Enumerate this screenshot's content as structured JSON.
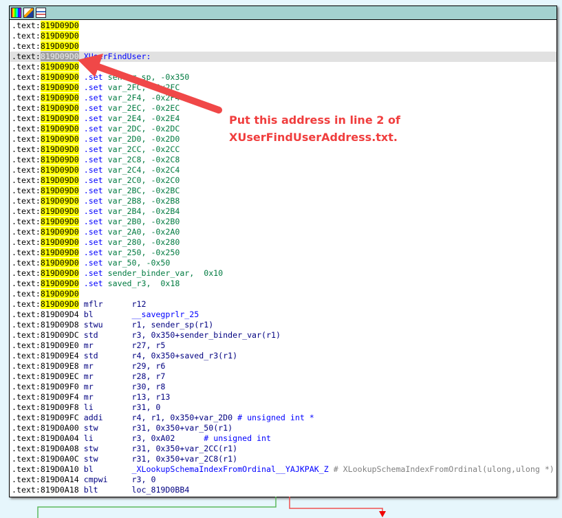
{
  "toolbar": {
    "icons": [
      "color-palette-icon",
      "edit-pencil-icon",
      "graph-view-icon"
    ]
  },
  "annotation": {
    "line1": "Put this address in line 2 of",
    "line2": "XUserFindUserAddress.txt.",
    "color": "#f04040"
  },
  "code_lines": [
    {
      "seg": ".text:",
      "addr": "819D09D0",
      "hl": true
    },
    {
      "seg": ".text:",
      "addr": "819D09D0",
      "hl": true
    },
    {
      "seg": ".text:",
      "addr": "819D09D0",
      "hl": true
    },
    {
      "seg": ".text:",
      "addr": "819D09D0",
      "hl": true,
      "label": "XUserFindUser:",
      "cur": true
    },
    {
      "seg": ".text:",
      "addr": "819D09D0",
      "hl": true
    },
    {
      "seg": ".text:",
      "addr": "819D09D0",
      "hl": true,
      "mn": ".set",
      "op": "sender_sp, -0x350"
    },
    {
      "seg": ".text:",
      "addr": "819D09D0",
      "hl": true,
      "mn": ".set",
      "op": "var_2FC, -0x2FC"
    },
    {
      "seg": ".text:",
      "addr": "819D09D0",
      "hl": true,
      "mn": ".set",
      "op": "var_2F4, -0x2F4"
    },
    {
      "seg": ".text:",
      "addr": "819D09D0",
      "hl": true,
      "mn": ".set",
      "op": "var_2EC, -0x2EC"
    },
    {
      "seg": ".text:",
      "addr": "819D09D0",
      "hl": true,
      "mn": ".set",
      "op": "var_2E4, -0x2E4"
    },
    {
      "seg": ".text:",
      "addr": "819D09D0",
      "hl": true,
      "mn": ".set",
      "op": "var_2DC, -0x2DC"
    },
    {
      "seg": ".text:",
      "addr": "819D09D0",
      "hl": true,
      "mn": ".set",
      "op": "var_2D0, -0x2D0"
    },
    {
      "seg": ".text:",
      "addr": "819D09D0",
      "hl": true,
      "mn": ".set",
      "op": "var_2CC, -0x2CC"
    },
    {
      "seg": ".text:",
      "addr": "819D09D0",
      "hl": true,
      "mn": ".set",
      "op": "var_2C8, -0x2C8"
    },
    {
      "seg": ".text:",
      "addr": "819D09D0",
      "hl": true,
      "mn": ".set",
      "op": "var_2C4, -0x2C4"
    },
    {
      "seg": ".text:",
      "addr": "819D09D0",
      "hl": true,
      "mn": ".set",
      "op": "var_2C0, -0x2C0"
    },
    {
      "seg": ".text:",
      "addr": "819D09D0",
      "hl": true,
      "mn": ".set",
      "op": "var_2BC, -0x2BC"
    },
    {
      "seg": ".text:",
      "addr": "819D09D0",
      "hl": true,
      "mn": ".set",
      "op": "var_2B8, -0x2B8"
    },
    {
      "seg": ".text:",
      "addr": "819D09D0",
      "hl": true,
      "mn": ".set",
      "op": "var_2B4, -0x2B4"
    },
    {
      "seg": ".text:",
      "addr": "819D09D0",
      "hl": true,
      "mn": ".set",
      "op": "var_2B0, -0x2B0"
    },
    {
      "seg": ".text:",
      "addr": "819D09D0",
      "hl": true,
      "mn": ".set",
      "op": "var_2A0, -0x2A0"
    },
    {
      "seg": ".text:",
      "addr": "819D09D0",
      "hl": true,
      "mn": ".set",
      "op": "var_280, -0x280"
    },
    {
      "seg": ".text:",
      "addr": "819D09D0",
      "hl": true,
      "mn": ".set",
      "op": "var_250, -0x250"
    },
    {
      "seg": ".text:",
      "addr": "819D09D0",
      "hl": true,
      "mn": ".set",
      "op": "var_50, -0x50"
    },
    {
      "seg": ".text:",
      "addr": "819D09D0",
      "hl": true,
      "mn": ".set",
      "op": "sender_binder_var,  0x10"
    },
    {
      "seg": ".text:",
      "addr": "819D09D0",
      "hl": true,
      "mn": ".set",
      "op": "saved_r3,  0x18"
    },
    {
      "seg": ".text:",
      "addr": "819D09D0",
      "hl": true
    },
    {
      "seg": ".text:",
      "addr": "819D09D0",
      "hl": true,
      "mn": "mflr",
      "op": "r12"
    },
    {
      "seg": ".text:",
      "addr": "819D09D4",
      "mn": "bl",
      "op": "__savegprlr_25"
    },
    {
      "seg": ".text:",
      "addr": "819D09D8",
      "mn": "stwu",
      "op": "r1, sender_sp(r1)"
    },
    {
      "seg": ".text:",
      "addr": "819D09DC",
      "mn": "std",
      "op": "r3, 0x350+sender_binder_var(r1)"
    },
    {
      "seg": ".text:",
      "addr": "819D09E0",
      "mn": "mr",
      "op": "r27, r5"
    },
    {
      "seg": ".text:",
      "addr": "819D09E4",
      "mn": "std",
      "op": "r4, 0x350+saved_r3(r1)"
    },
    {
      "seg": ".text:",
      "addr": "819D09E8",
      "mn": "mr",
      "op": "r29, r6"
    },
    {
      "seg": ".text:",
      "addr": "819D09EC",
      "mn": "mr",
      "op": "r28, r7"
    },
    {
      "seg": ".text:",
      "addr": "819D09F0",
      "mn": "mr",
      "op": "r30, r8"
    },
    {
      "seg": ".text:",
      "addr": "819D09F4",
      "mn": "mr",
      "op": "r13, r13"
    },
    {
      "seg": ".text:",
      "addr": "819D09F8",
      "mn": "li",
      "op": "r31, 0"
    },
    {
      "seg": ".text:",
      "addr": "819D09FC",
      "mn": "addi",
      "op": "r4, r1, 0x350+var_2D0",
      "cm": "# unsigned int *",
      "cmc": "blue"
    },
    {
      "seg": ".text:",
      "addr": "819D0A00",
      "mn": "stw",
      "op": "r31, 0x350+var_50(r1)"
    },
    {
      "seg": ".text:",
      "addr": "819D0A04",
      "mn": "li",
      "op": "r3, 0xA02     ",
      "cm": "# unsigned int",
      "cmc": "blue"
    },
    {
      "seg": ".text:",
      "addr": "819D0A08",
      "mn": "stw",
      "op": "r31, 0x350+var_2CC(r1)"
    },
    {
      "seg": ".text:",
      "addr": "819D0A0C",
      "mn": "stw",
      "op": "r31, 0x350+var_2C8(r1)"
    },
    {
      "seg": ".text:",
      "addr": "819D0A10",
      "mn": "bl",
      "op": "_XLookupSchemaIndexFromOrdinal__YAJKPAK_Z",
      "cm": "# XLookupSchemaIndexFromOrdinal(ulong,ulong *)",
      "cmc": "gray"
    },
    {
      "seg": ".text:",
      "addr": "819D0A14",
      "mn": "cmpwi",
      "op": "r3, 0"
    },
    {
      "seg": ".text:",
      "addr": "819D0A18",
      "mn": "blt",
      "op": "loc_819D0BB4"
    }
  ],
  "graph_edges": {
    "true_color": "#5cb85c",
    "false_color": "#f05050"
  }
}
